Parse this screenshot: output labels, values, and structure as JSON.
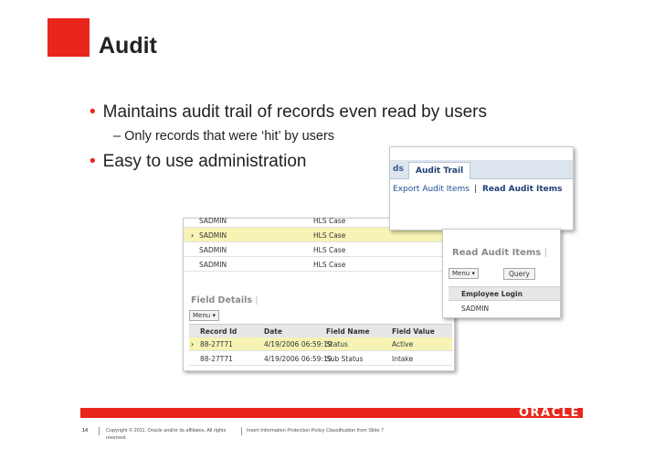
{
  "slide": {
    "title": "Audit",
    "bullets": [
      "Maintains audit trail of records even read by users",
      "Easy to use administration"
    ],
    "sub_bullet": "Only records that were ‘hit’ by users",
    "bullet_marker": "•",
    "sub_marker": "–",
    "accent_color": "#e8261c"
  },
  "main_shot": {
    "records": [
      {
        "user": "SADMIN",
        "type": "HLS Case"
      },
      {
        "user": "SADMIN",
        "type": "HLS Case"
      },
      {
        "user": "SADMIN",
        "type": "HLS Case"
      },
      {
        "user": "SADMIN",
        "type": "HLS Case"
      }
    ],
    "field_details_title": "Field Details",
    "menu_label": "Menu ▾",
    "columns": [
      "Record Id",
      "Date",
      "Field Name",
      "Field Value"
    ],
    "rows": [
      [
        "88-27T71",
        "4/19/2006 06:59:19",
        "Status",
        "Active"
      ],
      [
        "88-27T71",
        "4/19/2006 06:59:19",
        "Sub Status",
        "Intake"
      ]
    ]
  },
  "trail_shot": {
    "tab_prev": "ds",
    "tab_active": "Audit Trail",
    "link_export": "Export Audit Items",
    "separator": "|",
    "link_read": "Read Audit Items"
  },
  "read_shot": {
    "title": "Read Audit Items",
    "menu_label": "Menu ▾",
    "query_label": "Query",
    "column": "Employee Login",
    "value": "SADMIN"
  },
  "footer": {
    "logo": "ORACLE",
    "page_number": "14",
    "copyright": "Copyright © 2011, Oracle and/or its affiliates. All rights reserved.",
    "classification": "Insert Information Protection Policy Classification from Slide 7"
  }
}
